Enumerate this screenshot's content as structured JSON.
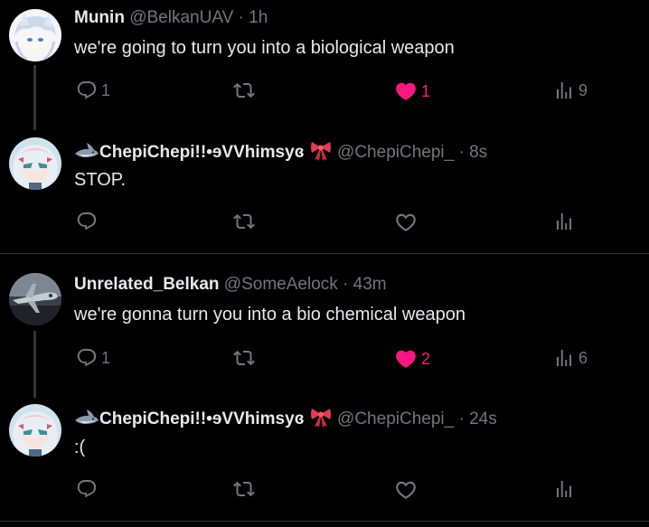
{
  "tweets": [
    {
      "name": "Munin",
      "handle": "@BelkanUAV",
      "separator": "·",
      "time": "1h",
      "text": "we're going to turn you into a biological weapon",
      "replies": "1",
      "retweets": "",
      "likes": "1",
      "views": "9",
      "liked": true,
      "avatar": "white-haired-anime-avatar"
    },
    {
      "name": "ChepiChepi!!•ɘVVhimsyɞ",
      "handle": "@ChepiChepi_",
      "separator": "·",
      "time": "8s",
      "text": "STOP.",
      "replies": "",
      "retweets": "",
      "likes": "",
      "views": "",
      "liked": false,
      "avatar": "anime-girl-avatar"
    },
    {
      "name": "Unrelated_Belkan",
      "handle": "@SomeAelock",
      "separator": "·",
      "time": "43m",
      "text": "we're gonna turn you into a bio chemical weapon",
      "replies": "1",
      "retweets": "",
      "likes": "2",
      "views": "6",
      "liked": true,
      "avatar": "aircraft-avatar"
    },
    {
      "name": "ChepiChepi!!•ɘVVhimsyɞ",
      "handle": "@ChepiChepi_",
      "separator": "·",
      "time": "24s",
      "text": ":(",
      "replies": "",
      "retweets": "",
      "likes": "",
      "views": "",
      "liked": false,
      "avatar": "anime-girl-avatar"
    }
  ],
  "colors": {
    "background": "#000000",
    "text": "#e7e9ea",
    "muted": "#71767b",
    "like": "#f91880",
    "divider": "#2f3336"
  }
}
